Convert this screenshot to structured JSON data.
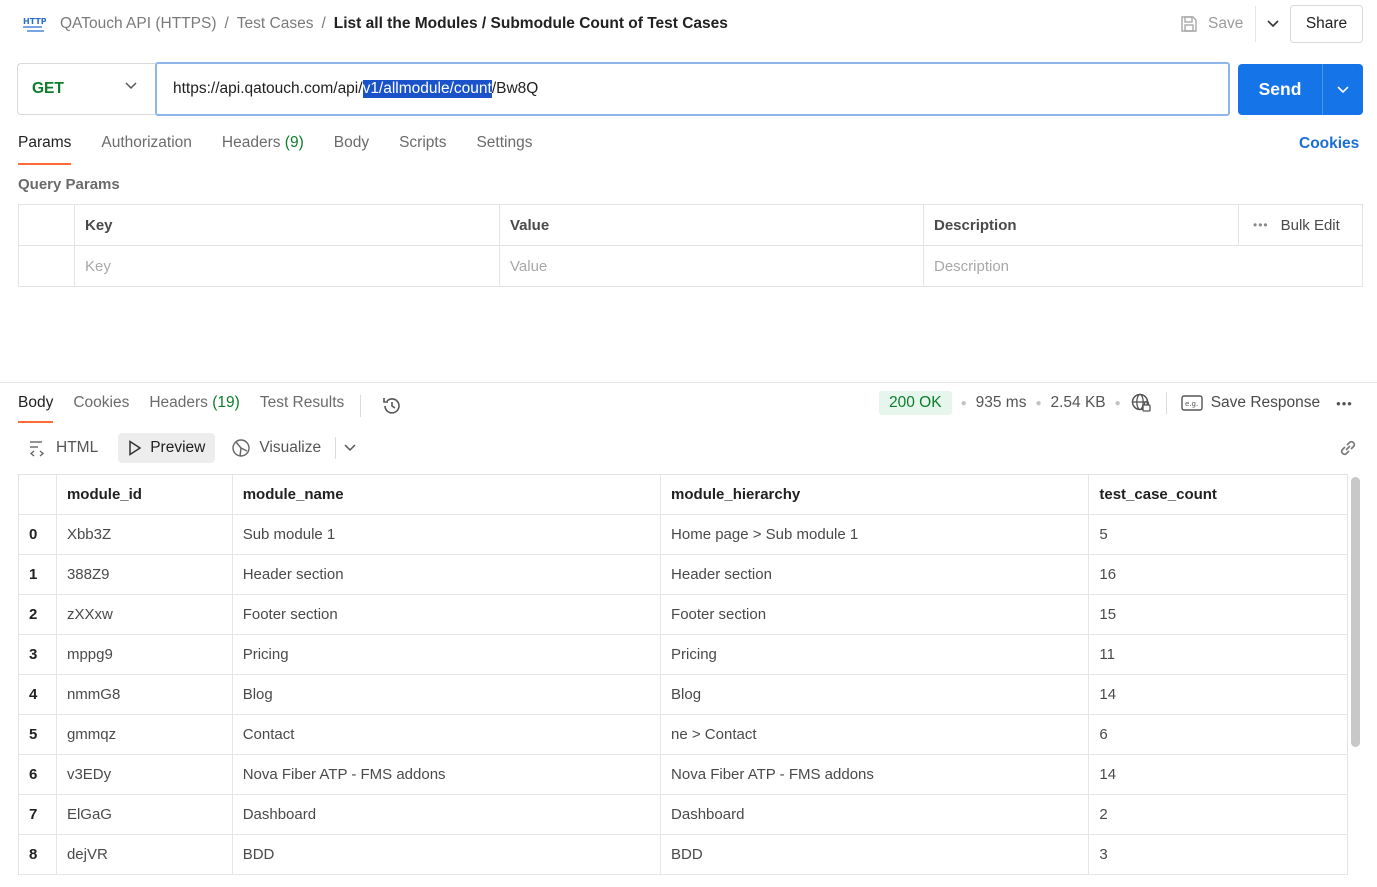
{
  "header": {
    "breadcrumb": [
      "QATouch API (HTTPS)",
      "Test Cases"
    ],
    "title": "List all the Modules / Submodule Count of Test Cases",
    "save_label": "Save",
    "share_label": "Share"
  },
  "request": {
    "method": "GET",
    "url_before": "https://api.qatouch.com/api/",
    "url_selected": "v1/allmodule/count",
    "url_after": "/Bw8Q",
    "send_label": "Send"
  },
  "request_tabs": {
    "params": "Params",
    "authorization": "Authorization",
    "headers": "Headers",
    "headers_count": "(9)",
    "body": "Body",
    "scripts": "Scripts",
    "settings": "Settings",
    "cookies": "Cookies"
  },
  "query_params": {
    "title": "Query Params",
    "columns": [
      "Key",
      "Value",
      "Description"
    ],
    "bulk_edit": "Bulk Edit",
    "placeholders": [
      "Key",
      "Value",
      "Description"
    ]
  },
  "response_tabs": {
    "body": "Body",
    "cookies": "Cookies",
    "headers": "Headers",
    "headers_count": "(19)",
    "test_results": "Test Results"
  },
  "status": {
    "code": "200 OK",
    "time": "935 ms",
    "size": "2.54 KB",
    "save_response": "Save Response"
  },
  "view_modes": {
    "html": "HTML",
    "preview": "Preview",
    "visualize": "Visualize"
  },
  "colors": {
    "accent_orange": "#ff6c37",
    "send_blue": "#1474e8",
    "method_green": "#0b7d2b",
    "selection_blue": "#1a53c9"
  },
  "table": {
    "columns": [
      "module_id",
      "module_name",
      "module_hierarchy",
      "test_case_count"
    ],
    "rows": [
      {
        "index": "0",
        "module_id": "Xbb3Z",
        "module_name": "Sub module 1",
        "module_hierarchy": "Home page > Sub module 1",
        "test_case_count": "5"
      },
      {
        "index": "1",
        "module_id": "388Z9",
        "module_name": "Header section",
        "module_hierarchy": "Header section",
        "test_case_count": "16"
      },
      {
        "index": "2",
        "module_id": "zXXxw",
        "module_name": "Footer section",
        "module_hierarchy": "Footer section",
        "test_case_count": "15"
      },
      {
        "index": "3",
        "module_id": "mppg9",
        "module_name": "Pricing",
        "module_hierarchy": "Pricing",
        "test_case_count": "11"
      },
      {
        "index": "4",
        "module_id": "nmmG8",
        "module_name": "Blog",
        "module_hierarchy": "Blog",
        "test_case_count": "14"
      },
      {
        "index": "5",
        "module_id": "gmmqz",
        "module_name": "Contact",
        "module_hierarchy": "ne > Contact",
        "test_case_count": "6"
      },
      {
        "index": "6",
        "module_id": "v3EDy",
        "module_name": "Nova Fiber ATP - FMS addons",
        "module_hierarchy": "Nova Fiber ATP - FMS addons",
        "test_case_count": "14"
      },
      {
        "index": "7",
        "module_id": "ElGaG",
        "module_name": "Dashboard",
        "module_hierarchy": "Dashboard",
        "test_case_count": "2"
      },
      {
        "index": "8",
        "module_id": "dejVR",
        "module_name": "BDD",
        "module_hierarchy": "BDD",
        "test_case_count": "3"
      }
    ]
  }
}
